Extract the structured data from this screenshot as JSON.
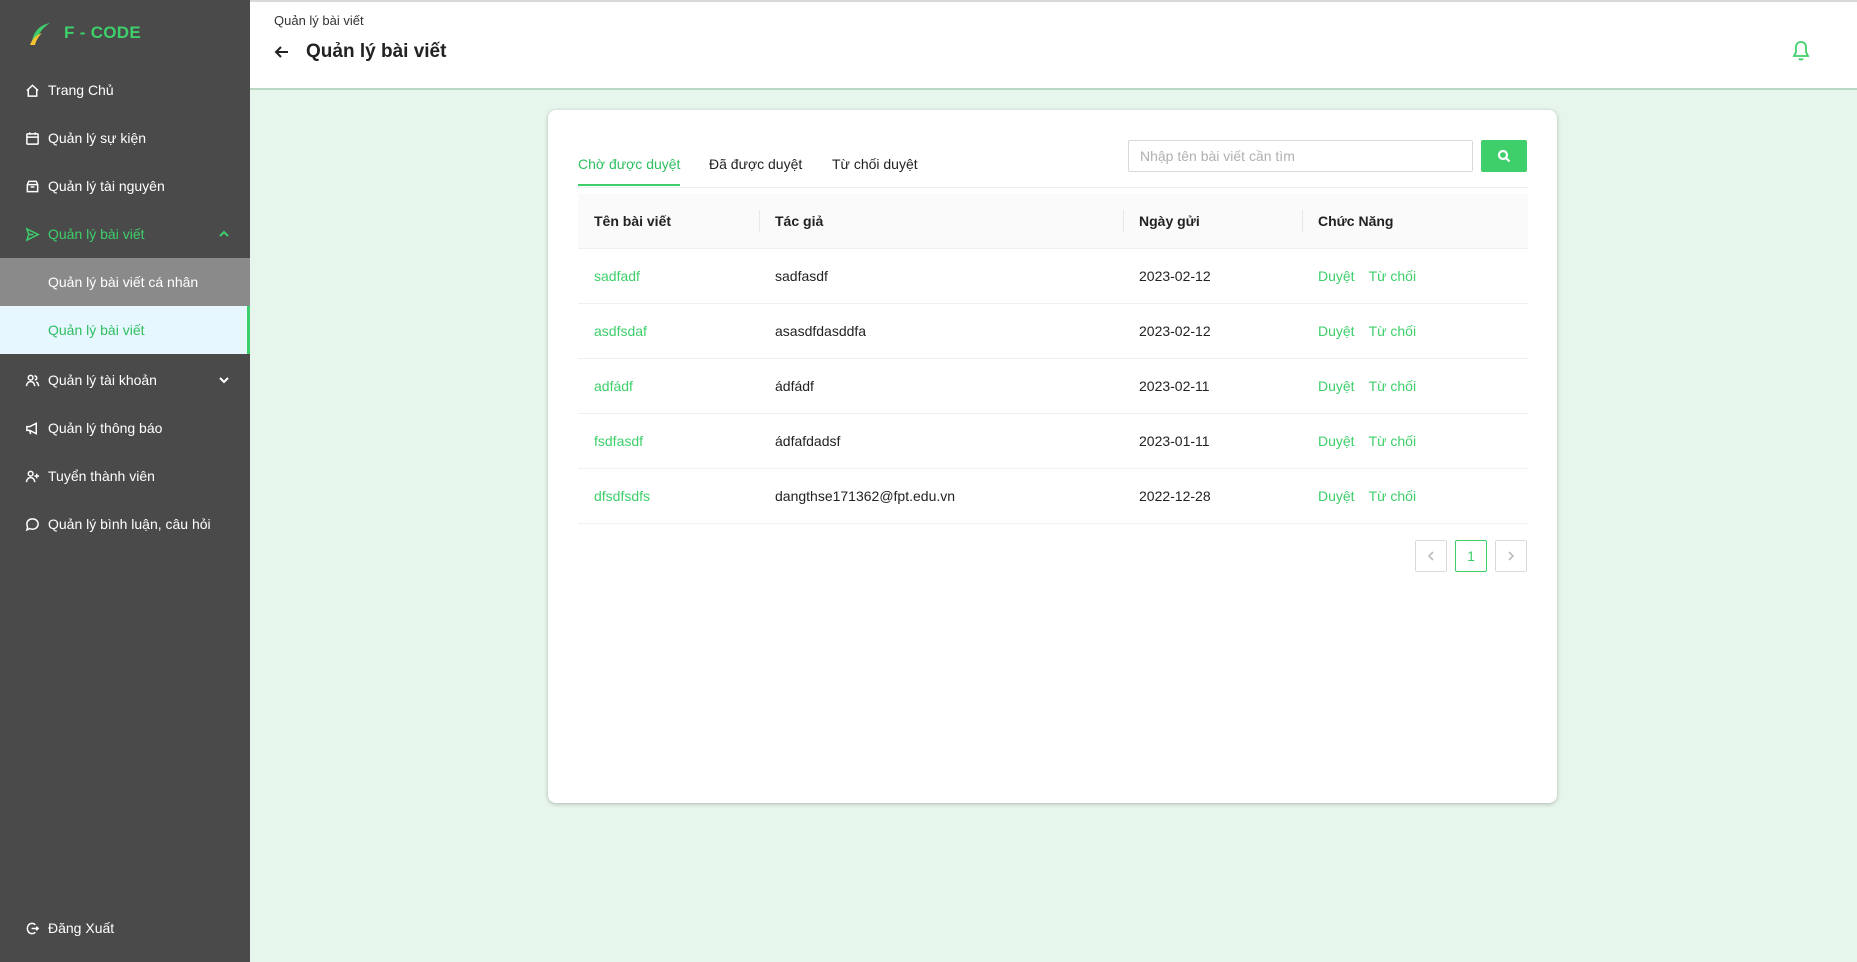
{
  "brand": {
    "name": "F - CODE"
  },
  "sidebar": {
    "items": [
      {
        "label": "Trang Chủ",
        "icon": "home-icon"
      },
      {
        "label": "Quản lý sự kiện",
        "icon": "calendar-icon"
      },
      {
        "label": "Quản lý tài nguyên",
        "icon": "box-icon"
      },
      {
        "label": "Quản lý bài viết",
        "icon": "send-icon",
        "expanded": true,
        "children": [
          {
            "label": "Quản lý bài viết cá nhân"
          },
          {
            "label": "Quản lý bài viết",
            "selected": true
          }
        ]
      },
      {
        "label": "Quản lý tài khoản",
        "icon": "users-icon"
      },
      {
        "label": "Quản lý thông báo",
        "icon": "megaphone-icon"
      },
      {
        "label": "Tuyển thành viên",
        "icon": "user-add-icon"
      },
      {
        "label": "Quản lý bình luận, câu hỏi",
        "icon": "comment-icon"
      }
    ],
    "logout": "Đăng Xuất"
  },
  "header": {
    "breadcrumb": "Quản lý bài viết",
    "title": "Quản lý bài viết"
  },
  "tabs": [
    {
      "label": "Chờ được duyệt",
      "active": true
    },
    {
      "label": "Đã được duyệt"
    },
    {
      "label": "Từ chối duyệt"
    }
  ],
  "search": {
    "placeholder": "Nhập tên bài viết cần tìm",
    "value": ""
  },
  "table": {
    "columns": [
      "Tên bài viết",
      "Tác giả",
      "Ngày gửi",
      "Chức Năng"
    ],
    "rows": [
      {
        "title": "sadfadf",
        "author": "sadfasdf",
        "date": "2023-02-12"
      },
      {
        "title": "asdfsdaf",
        "author": "asasdfdasddfa",
        "date": "2023-02-12"
      },
      {
        "title": "adfádf",
        "author": "ádfádf",
        "date": "2023-02-11"
      },
      {
        "title": "fsdfasdf",
        "author": "ádfafdadsf",
        "date": "2023-01-11"
      },
      {
        "title": "dfsdfsdfs",
        "author": "dangthse171362@fpt.edu.vn",
        "date": "2022-12-28"
      }
    ],
    "actions": {
      "approve": "Duyệt",
      "reject": "Từ chối"
    }
  },
  "pagination": {
    "current": "1"
  },
  "colors": {
    "accent": "#3ecf6b",
    "sidebar_bg": "#4a4a4a",
    "page_bg": "#e6f6ec"
  }
}
